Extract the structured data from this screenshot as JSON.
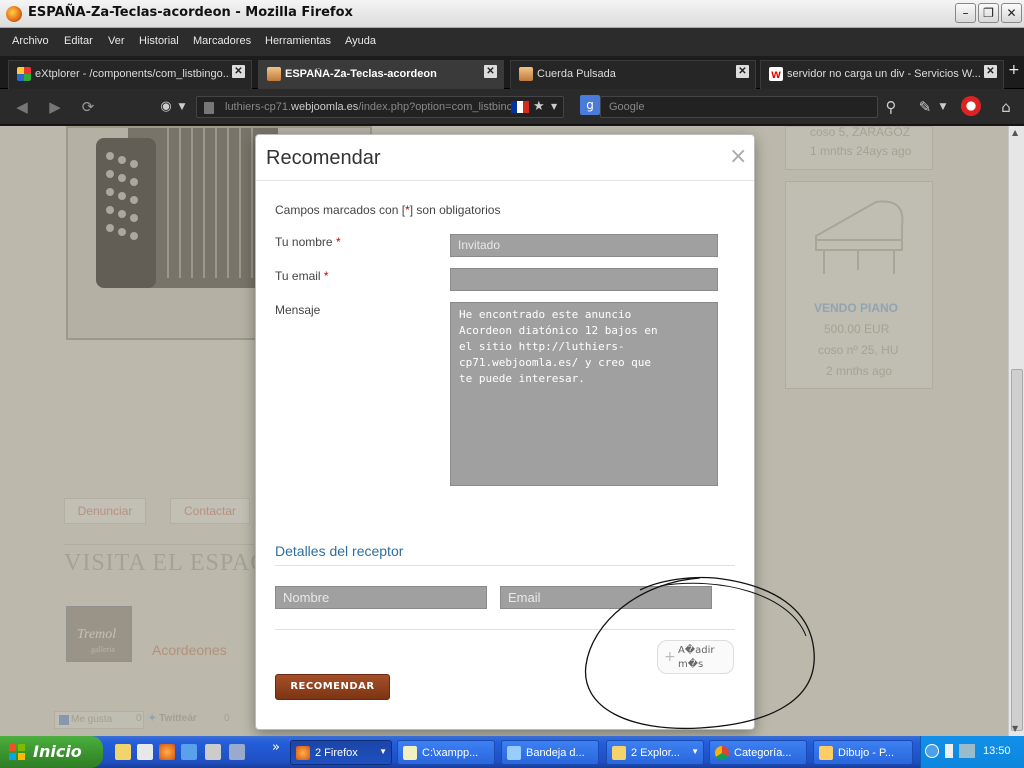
{
  "window": {
    "title": "ESPAÑA-Za-Teclas-acordeon - Mozilla Firefox"
  },
  "menu": [
    "Archivo",
    "Editar",
    "Ver",
    "Historial",
    "Marcadores",
    "Herramientas",
    "Ayuda"
  ],
  "tabs": [
    {
      "label": "eXtplorer - /components/com_listbingo..."
    },
    {
      "label": "ESPAÑA-Za-Teclas-acordeon"
    },
    {
      "label": "Cuerda Pulsada"
    },
    {
      "label": "servidor no carga un div - Servicios W..."
    }
  ],
  "address": {
    "prefix": "luthiers-cp71.",
    "domain": "webjoomla.es",
    "path": "/index.php?option=com_listbinc"
  },
  "search": {
    "placeholder": "Google"
  },
  "background": {
    "card_loc": "coso 5, ZARAGOZ",
    "card_time": "1 mnths 24ays ago",
    "piano_title": "VENDO PIANO",
    "piano_price": "500.00 EUR",
    "piano_loc": "coso nº 25, HU",
    "piano_time": "2 mnths ago",
    "denunciar": "Denunciar",
    "contactar": "Contactar",
    "visita": "VISITA EL ESPAC",
    "tremol": "Tremol",
    "tremol_sub": "galleria",
    "acordeones": "Acordeones",
    "megusta": "Me gusta",
    "megusta_count": "0",
    "twitter": "Twitteár",
    "twitter_count": "0"
  },
  "modal": {
    "title": "Recomendar",
    "required_note_pre": "Campos marcados con [",
    "required_note_star": "*",
    "required_note_post": "] son obligatorios",
    "name_label": "Tu nombre",
    "name_value": "Invitado",
    "email_label": "Tu email",
    "email_value": "",
    "message_label": "Mensaje",
    "message_value": "He encontrado este anuncio\nAcordeon diatónico 12 bajos en\nel sitio http://luthiers-\ncp71.webjoomla.es/ y creo que\nte puede interesar.",
    "recipient_header": "Detalles del receptor",
    "recipient_name_placeholder": "Nombre",
    "recipient_email_placeholder": "Email",
    "add_more": "A�adir\nm�s",
    "submit": "RECOMENDAR"
  },
  "taskbar": {
    "start": "Inicio",
    "items": [
      {
        "label": "2 Firefox"
      },
      {
        "label": "C:\\xampp..."
      },
      {
        "label": "Bandeja d..."
      },
      {
        "label": "2 Explor..."
      },
      {
        "label": "Categoría..."
      },
      {
        "label": "Dibujo - P..."
      }
    ],
    "clock": "13:50"
  },
  "colors": {
    "accent_link": "#2f6f9f",
    "submit_button": "#8a3d19",
    "required": "#c00000",
    "taskbar": "#245edb",
    "start": "#3b962f"
  }
}
